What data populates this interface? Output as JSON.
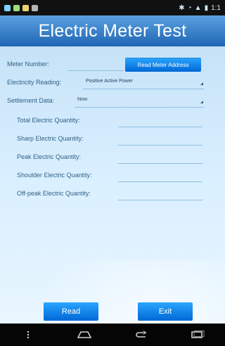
{
  "app": {
    "title": "Electric Meter Test"
  },
  "status_bar": {
    "time": "1:1"
  },
  "meter": {
    "number_label": "Meter Number:",
    "number_value": "",
    "read_address_button": "Read Meter Address"
  },
  "electricity_reading": {
    "label": "Electricity Reading:",
    "selected": "Positive Active Power"
  },
  "settlement_data": {
    "label": "Settlement Data:",
    "selected": "Now"
  },
  "quantities": {
    "total_label": "Total Electric Quantity:",
    "sharp_label": "Sharp Electric Quantity:",
    "peak_label": "Peak Electric Quantity:",
    "shoulder_label": "Shoulder Electric Quantity:",
    "offpeak_label": "Off-peak Electric Quantity:",
    "total_value": "",
    "sharp_value": "",
    "peak_value": "",
    "shoulder_value": "",
    "offpeak_value": ""
  },
  "actions": {
    "read_button": "Read",
    "exit_button": "Exit"
  },
  "colors": {
    "title_bar": "#1f66b5",
    "accent_button": "#0068d6",
    "content_bg": "#d9efff"
  },
  "icons": {
    "status": [
      "notification-icons",
      "wifi-icon",
      "bluetooth-icon",
      "signal-icon",
      "battery-icon"
    ],
    "nav": [
      "menu-icon",
      "home-icon",
      "back-icon",
      "recent-apps-icon"
    ]
  }
}
